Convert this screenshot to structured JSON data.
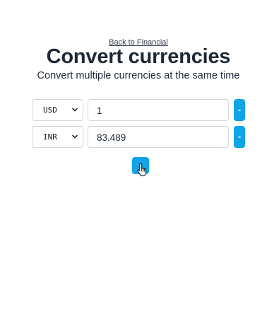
{
  "header": {
    "back_link": "Back to Financial",
    "title": "Convert currencies",
    "subtitle": "Convert multiple currencies at the same time"
  },
  "rows": [
    {
      "currency": "USD",
      "amount": "1",
      "remove_label": "-"
    },
    {
      "currency": "INR",
      "amount": "83.489",
      "remove_label": "-"
    }
  ],
  "add_button": {
    "label": ""
  },
  "colors": {
    "accent": "#0ea5e9",
    "text": "#1f2937",
    "border": "#d1d5db"
  },
  "icons": {
    "select_chevron": "chevron-down-icon",
    "cursor": "hand-cursor-icon"
  }
}
